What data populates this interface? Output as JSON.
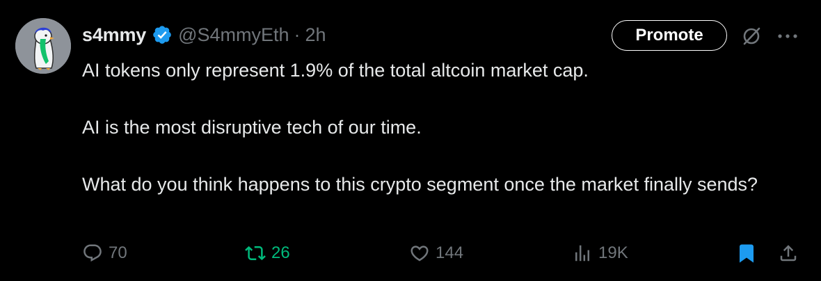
{
  "author": {
    "display_name": "s4mmy",
    "handle": "@S4mmyEth",
    "separator": "·",
    "time": "2h",
    "verified": true,
    "avatar": "penguin-avatar"
  },
  "header_actions": {
    "promote_label": "Promote",
    "grok_icon": "grok-icon",
    "more_icon": "more-icon"
  },
  "tweet": {
    "paragraphs": [
      "AI tokens only represent 1.9% of the total altcoin market cap.",
      "AI is the most disruptive tech of our time.",
      "What do you think happens to this crypto segment once the market finally sends?"
    ]
  },
  "metrics": {
    "replies": "70",
    "reposts": "26",
    "likes": "144",
    "views": "19K"
  },
  "state": {
    "reposted": true,
    "bookmarked": true
  },
  "colors": {
    "background": "#000000",
    "text": "#e7e9ea",
    "secondary": "#71767b",
    "repost_active": "#00ba7c",
    "bookmark_active": "#1d9bf0",
    "verified": "#1d9bf0"
  }
}
